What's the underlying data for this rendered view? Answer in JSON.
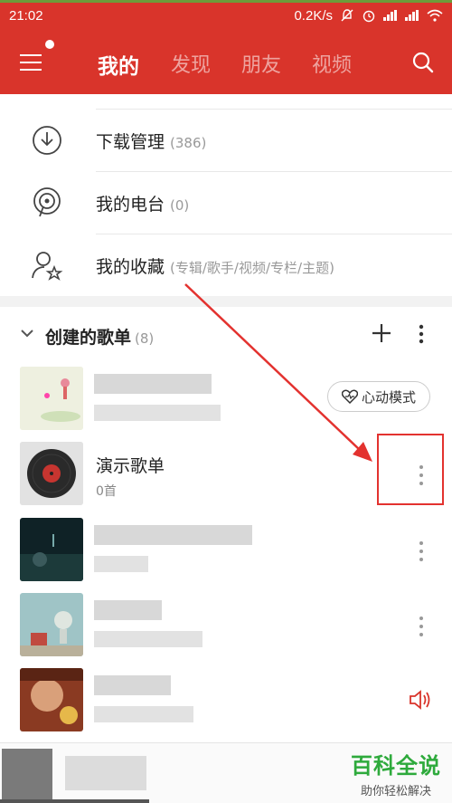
{
  "status_bar": {
    "time": "21:02",
    "speed": "0.2K/s"
  },
  "nav": {
    "tabs": [
      {
        "label": "我的",
        "active": true
      },
      {
        "label": "发现",
        "active": false
      },
      {
        "label": "朋友",
        "active": false
      },
      {
        "label": "视频",
        "active": false
      }
    ],
    "menu_icon": "hamburger-icon",
    "search_icon": "search-icon"
  },
  "quick_list": [
    {
      "icon": "download-icon",
      "label": "下载管理",
      "count": "(386)"
    },
    {
      "icon": "radio-icon",
      "label": "我的电台",
      "count": "(0)"
    },
    {
      "icon": "favorite-user-icon",
      "label": "我的收藏",
      "count": "(专辑/歌手/视频/专栏/主题)"
    }
  ],
  "created_playlists": {
    "title": "创建的歌单",
    "count": "(8)",
    "heart_mode_label": "心动模式",
    "items": [
      {
        "title": "",
        "subtitle": ""
      },
      {
        "title": "演示歌单",
        "subtitle": "0首"
      },
      {
        "title": "",
        "subtitle": ""
      },
      {
        "title": "",
        "subtitle": ""
      },
      {
        "title": "",
        "subtitle": ""
      }
    ]
  },
  "watermark": {
    "title": "百科全说",
    "subtitle": "助你轻松解决"
  },
  "colors": {
    "brand_red": "#d9342b",
    "highlight_red": "#e3322f",
    "watermark_green": "#2eaa3c"
  }
}
